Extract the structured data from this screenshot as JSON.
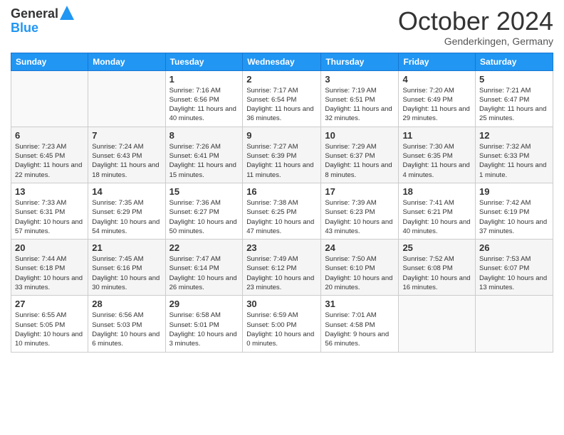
{
  "logo": {
    "line1": "General",
    "line2": "Blue"
  },
  "header": {
    "month": "October 2024",
    "location": "Genderkingen, Germany"
  },
  "days_of_week": [
    "Sunday",
    "Monday",
    "Tuesday",
    "Wednesday",
    "Thursday",
    "Friday",
    "Saturday"
  ],
  "weeks": [
    [
      {
        "day": "",
        "info": ""
      },
      {
        "day": "",
        "info": ""
      },
      {
        "day": "1",
        "info": "Sunrise: 7:16 AM\nSunset: 6:56 PM\nDaylight: 11 hours and 40 minutes."
      },
      {
        "day": "2",
        "info": "Sunrise: 7:17 AM\nSunset: 6:54 PM\nDaylight: 11 hours and 36 minutes."
      },
      {
        "day": "3",
        "info": "Sunrise: 7:19 AM\nSunset: 6:51 PM\nDaylight: 11 hours and 32 minutes."
      },
      {
        "day": "4",
        "info": "Sunrise: 7:20 AM\nSunset: 6:49 PM\nDaylight: 11 hours and 29 minutes."
      },
      {
        "day": "5",
        "info": "Sunrise: 7:21 AM\nSunset: 6:47 PM\nDaylight: 11 hours and 25 minutes."
      }
    ],
    [
      {
        "day": "6",
        "info": "Sunrise: 7:23 AM\nSunset: 6:45 PM\nDaylight: 11 hours and 22 minutes."
      },
      {
        "day": "7",
        "info": "Sunrise: 7:24 AM\nSunset: 6:43 PM\nDaylight: 11 hours and 18 minutes."
      },
      {
        "day": "8",
        "info": "Sunrise: 7:26 AM\nSunset: 6:41 PM\nDaylight: 11 hours and 15 minutes."
      },
      {
        "day": "9",
        "info": "Sunrise: 7:27 AM\nSunset: 6:39 PM\nDaylight: 11 hours and 11 minutes."
      },
      {
        "day": "10",
        "info": "Sunrise: 7:29 AM\nSunset: 6:37 PM\nDaylight: 11 hours and 8 minutes."
      },
      {
        "day": "11",
        "info": "Sunrise: 7:30 AM\nSunset: 6:35 PM\nDaylight: 11 hours and 4 minutes."
      },
      {
        "day": "12",
        "info": "Sunrise: 7:32 AM\nSunset: 6:33 PM\nDaylight: 11 hours and 1 minute."
      }
    ],
    [
      {
        "day": "13",
        "info": "Sunrise: 7:33 AM\nSunset: 6:31 PM\nDaylight: 10 hours and 57 minutes."
      },
      {
        "day": "14",
        "info": "Sunrise: 7:35 AM\nSunset: 6:29 PM\nDaylight: 10 hours and 54 minutes."
      },
      {
        "day": "15",
        "info": "Sunrise: 7:36 AM\nSunset: 6:27 PM\nDaylight: 10 hours and 50 minutes."
      },
      {
        "day": "16",
        "info": "Sunrise: 7:38 AM\nSunset: 6:25 PM\nDaylight: 10 hours and 47 minutes."
      },
      {
        "day": "17",
        "info": "Sunrise: 7:39 AM\nSunset: 6:23 PM\nDaylight: 10 hours and 43 minutes."
      },
      {
        "day": "18",
        "info": "Sunrise: 7:41 AM\nSunset: 6:21 PM\nDaylight: 10 hours and 40 minutes."
      },
      {
        "day": "19",
        "info": "Sunrise: 7:42 AM\nSunset: 6:19 PM\nDaylight: 10 hours and 37 minutes."
      }
    ],
    [
      {
        "day": "20",
        "info": "Sunrise: 7:44 AM\nSunset: 6:18 PM\nDaylight: 10 hours and 33 minutes."
      },
      {
        "day": "21",
        "info": "Sunrise: 7:45 AM\nSunset: 6:16 PM\nDaylight: 10 hours and 30 minutes."
      },
      {
        "day": "22",
        "info": "Sunrise: 7:47 AM\nSunset: 6:14 PM\nDaylight: 10 hours and 26 minutes."
      },
      {
        "day": "23",
        "info": "Sunrise: 7:49 AM\nSunset: 6:12 PM\nDaylight: 10 hours and 23 minutes."
      },
      {
        "day": "24",
        "info": "Sunrise: 7:50 AM\nSunset: 6:10 PM\nDaylight: 10 hours and 20 minutes."
      },
      {
        "day": "25",
        "info": "Sunrise: 7:52 AM\nSunset: 6:08 PM\nDaylight: 10 hours and 16 minutes."
      },
      {
        "day": "26",
        "info": "Sunrise: 7:53 AM\nSunset: 6:07 PM\nDaylight: 10 hours and 13 minutes."
      }
    ],
    [
      {
        "day": "27",
        "info": "Sunrise: 6:55 AM\nSunset: 5:05 PM\nDaylight: 10 hours and 10 minutes."
      },
      {
        "day": "28",
        "info": "Sunrise: 6:56 AM\nSunset: 5:03 PM\nDaylight: 10 hours and 6 minutes."
      },
      {
        "day": "29",
        "info": "Sunrise: 6:58 AM\nSunset: 5:01 PM\nDaylight: 10 hours and 3 minutes."
      },
      {
        "day": "30",
        "info": "Sunrise: 6:59 AM\nSunset: 5:00 PM\nDaylight: 10 hours and 0 minutes."
      },
      {
        "day": "31",
        "info": "Sunrise: 7:01 AM\nSunset: 4:58 PM\nDaylight: 9 hours and 56 minutes."
      },
      {
        "day": "",
        "info": ""
      },
      {
        "day": "",
        "info": ""
      }
    ]
  ]
}
